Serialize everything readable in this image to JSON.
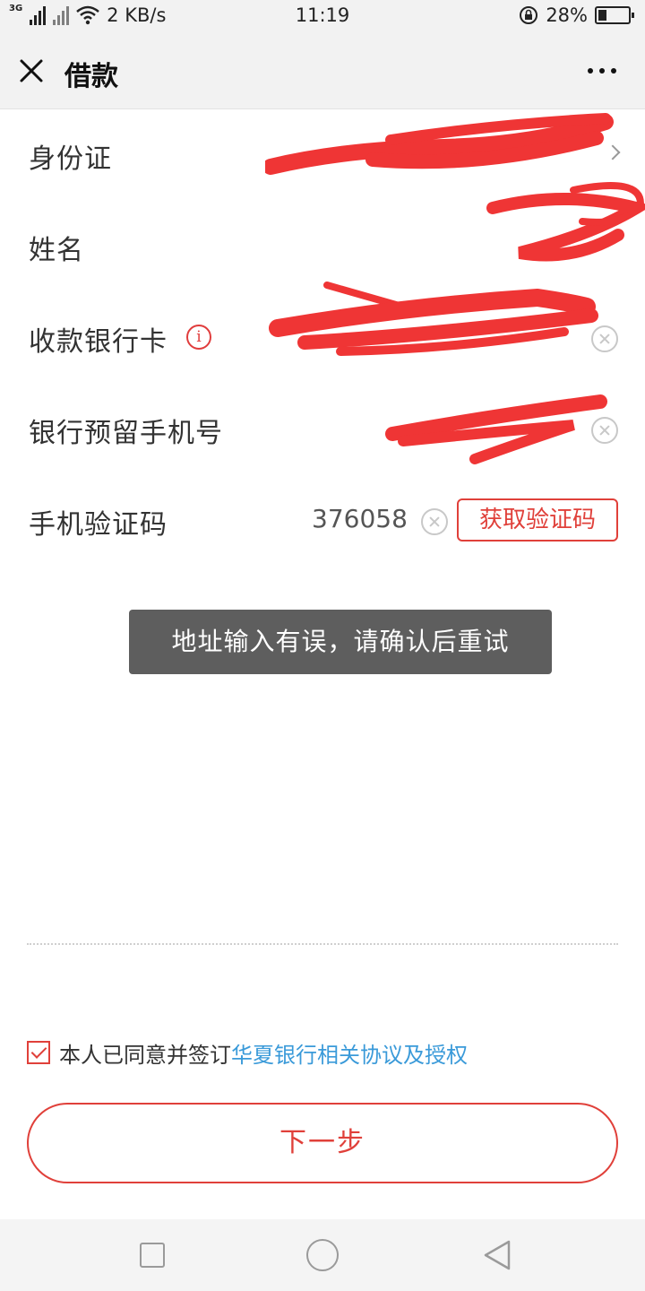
{
  "status_bar": {
    "network_tag": "3G",
    "speed": "2 KB/s",
    "time": "11:19",
    "battery": "28%",
    "battery_level": 0.28
  },
  "nav": {
    "title": "借款"
  },
  "form": {
    "id_card": {
      "label": "身份证"
    },
    "name": {
      "label": "姓名"
    },
    "bank_card": {
      "label": "收款银行卡"
    },
    "bank_phone": {
      "label": "银行预留手机号"
    },
    "sms_code": {
      "label": "手机验证码",
      "value": "376058",
      "button_label": "获取验证码"
    }
  },
  "toast": {
    "message": "地址输入有误，请确认后重试"
  },
  "agreement": {
    "checked": true,
    "text": "本人已同意并签订",
    "link": "华夏银行相关协议及授权"
  },
  "next_button": {
    "label": "下一步"
  },
  "colors": {
    "accent_red": "#e0403a",
    "link_blue": "#3a9ad9",
    "toast_bg": "#5e5e5e",
    "redaction": "#ef3535"
  }
}
